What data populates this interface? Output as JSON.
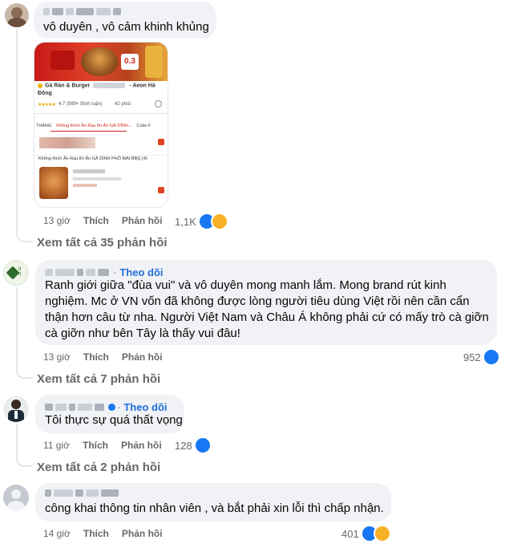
{
  "comments": [
    {
      "text": "vô duyên , vô cảm khinh khủng",
      "time": "13 giờ",
      "like_label": "Thích",
      "reply_label": "Phản hồi",
      "reactions_count": "1,1K",
      "view_replies": "Xem tất cả 35 phản hồi",
      "attachment": {
        "store_name_line1": "Gà Rán & Burger",
        "store_name_suffix": "- Aeon Hà",
        "store_name_line2": "Đông",
        "rating": "4.7 (999+ Bình luận)",
        "distance": "42 phút",
        "tab_1": "THÁNG",
        "tab_2": "Không thích Ăn Rau thì Ăn GÀ DÌNH...",
        "tab_3": "Coke F",
        "section_title": "Không thích Ăn Rau thì Ăn GÀ DÌNH PHÔ MAI BBQ (4)",
        "price_tag": "0.3"
      }
    },
    {
      "follow_label": "Theo dõi",
      "text": "Ranh giới giữa \"đùa vui\" và vô duyên mong manh lắm. Mong brand rút kinh nghiệm. Mc ở VN vốn đã không được lòng người tiêu dùng Việt rồi nên cần cẩn thận hơn câu từ nha. Người Việt Nam và Châu Á không phải cứ có mấy trò cà giỡn cà giỡn như bên Tây là thấy vui đâu!",
      "time": "13 giờ",
      "like_label": "Thích",
      "reply_label": "Phản hồi",
      "reactions_count": "952",
      "view_replies": "Xem tất cả 7 phản hồi"
    },
    {
      "follow_label": "Theo dõi",
      "text": "Tôi thực sự quá thất vọng",
      "time": "11 giờ",
      "like_label": "Thích",
      "reply_label": "Phản hồi",
      "reactions_count": "128",
      "view_replies": "Xem tất cả 2 phản hồi"
    },
    {
      "text": "công khai thông tin nhân viên , và bắt phải xin lỗi thì chấp nhận.",
      "time": "14 giờ",
      "like_label": "Thích",
      "reply_label": "Phản hồi",
      "reactions_count": "401"
    }
  ],
  "colors": {
    "accent": "#216fdb",
    "like": "#1877f2",
    "bubble": "#f0f2f5",
    "meta": "#65676b"
  },
  "icons": [
    "like-icon",
    "sad-icon",
    "haha-icon",
    "verified-icon",
    "avatar"
  ]
}
